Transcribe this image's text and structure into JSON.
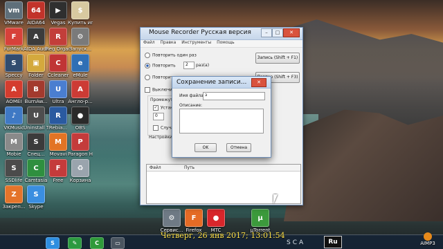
{
  "desktop": {
    "icons": [
      {
        "label": "VMware",
        "color": "#5f6f7a",
        "glyph": "vm"
      },
      {
        "label": "AIDA64",
        "color": "#c2332a",
        "glyph": "64"
      },
      {
        "label": "Vegas",
        "color": "#2f2f2f",
        "glyph": "▶"
      },
      {
        "label": "Купить игры",
        "color": "#d8c9a0",
        "glyph": "$"
      },
      {
        "label": "FurMark",
        "color": "#d7413a",
        "glyph": "F"
      },
      {
        "label": "AIDA Audio",
        "color": "#3c3c3c",
        "glyph": "A"
      },
      {
        "label": "Reg Organi...",
        "color": "#c23e3a",
        "glyph": "R"
      },
      {
        "label": "Запуск...",
        "color": "#7a7a7a",
        "glyph": "⚙"
      },
      {
        "label": "Speccy",
        "color": "#324c6f",
        "glyph": "S"
      },
      {
        "label": "Folder",
        "color": "#d4a93d",
        "glyph": "▣"
      },
      {
        "label": "Ccleaner",
        "color": "#c03535",
        "glyph": "C"
      },
      {
        "label": "eMule",
        "color": "#2f6fb5",
        "glyph": "e"
      },
      {
        "label": "AOMEI",
        "color": "#d43c2e",
        "glyph": "A"
      },
      {
        "label": "BurnAw...",
        "color": "#a33a2e",
        "glyph": "B"
      },
      {
        "label": "Ultra",
        "color": "#4a7ed0",
        "glyph": "U"
      },
      {
        "label": "Англо-р...",
        "color": "#cc3b35",
        "glyph": "А"
      },
      {
        "label": "VKMusic",
        "color": "#3f79c4",
        "glyph": "♪"
      },
      {
        "label": "Uninstall Tool",
        "color": "#4e4e4e",
        "glyph": "U"
      },
      {
        "label": "Rebia...",
        "color": "#2a5aa0",
        "glyph": "R"
      },
      {
        "label": "OBS",
        "color": "#2a2a2a",
        "glyph": "●"
      },
      {
        "label": "Mobie",
        "color": "#8a8a8a",
        "glyph": "M"
      },
      {
        "label": "Спец...",
        "color": "#3b3b3b",
        "glyph": "S"
      },
      {
        "label": "Movavi",
        "color": "#e27424",
        "glyph": "M"
      },
      {
        "label": "Paragon Hard D...",
        "color": "#c43b3b",
        "glyph": "P"
      },
      {
        "label": "SSDlife",
        "color": "#4b4b4b",
        "glyph": "S"
      },
      {
        "label": "Camtasia",
        "color": "#2f8f3f",
        "glyph": "C"
      },
      {
        "label": "Free",
        "color": "#c43b3b",
        "glyph": "F"
      },
      {
        "label": "Корзина",
        "color": "#9aa4ad",
        "glyph": "♻"
      },
      {
        "label": "Закреп...",
        "color": "#e4742a",
        "glyph": "Z"
      },
      {
        "label": "Skype",
        "color": "#3a8ee0",
        "glyph": "S"
      }
    ],
    "bottom_icons": [
      {
        "label": "Сервис...",
        "color": "#6f7a85",
        "glyph": "⚙"
      },
      {
        "label": "Firefox",
        "color": "#e56b25",
        "glyph": "F"
      },
      {
        "label": "MTC",
        "color": "#d8262b",
        "glyph": "●"
      },
      {
        "label": "μTorrent",
        "color": "#3c9a3c",
        "glyph": "μ"
      }
    ]
  },
  "main_window": {
    "title": "Mouse Recorder Русская версия",
    "menu": [
      "Файл",
      "Правка",
      "Инструменты",
      "Помощь"
    ],
    "options": {
      "repeat_once": "Повторить один раз",
      "repeat": "Повторить",
      "repeat_count": "2",
      "times_suffix": "раз(а)",
      "repeat_until": "Повторить",
      "disable": "Выключить п",
      "interval": "Промежуток в",
      "set": "Установ",
      "random": "Случайн",
      "settings": "Настройки ск",
      "interval_value": "0"
    },
    "buttons": {
      "record": "Запись (Shift + F1)",
      "replay": "Повтор (Shift + F3)"
    },
    "list_headers": [
      "Файл",
      "Путь"
    ]
  },
  "save_dialog": {
    "title": "Сохранение записи...",
    "filename_label": "Имя файла:",
    "filename_value": "з",
    "description_label": "Описание:",
    "ok_label": "OK",
    "cancel_label": "Отмена"
  },
  "taskbar": {
    "datetime": "Четверг, 26 янв 2017; 13:01:54",
    "brand": "SCA",
    "language": "Ru",
    "tray_label": "AIMP3",
    "apps": [
      {
        "glyph": "S",
        "color": "#2e8ee0"
      },
      {
        "glyph": "✎",
        "color": "#2c9a40"
      },
      {
        "glyph": "C",
        "color": "#2f9a3a"
      },
      {
        "glyph": "▭",
        "color": "#4a5560"
      }
    ]
  },
  "accent": "#2a5db0"
}
